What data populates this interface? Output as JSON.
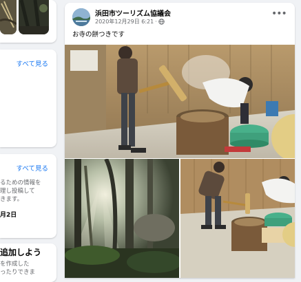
{
  "left": {
    "see_all_1": "すべて見る",
    "see_all_2": "すべて見る",
    "info_lines": [
      "るための情報を",
      "理し投稿して",
      "きます。"
    ],
    "date": "月2日",
    "add_title": "追加しよう",
    "add_lines": [
      "を作成した",
      "ったりできま"
    ]
  },
  "post": {
    "page_name": "浜田市ツーリズム協議会",
    "timestamp": "2020年12月29日 6:21",
    "separator": "·",
    "privacy_icon": "globe-icon",
    "more_icon": "ellipsis-icon",
    "more_label": "•••",
    "caption": "お寺の餅つきです",
    "photos": [
      "mochi-pounding-main",
      "forest-sunbeams",
      "mochi-pounding-second"
    ]
  }
}
